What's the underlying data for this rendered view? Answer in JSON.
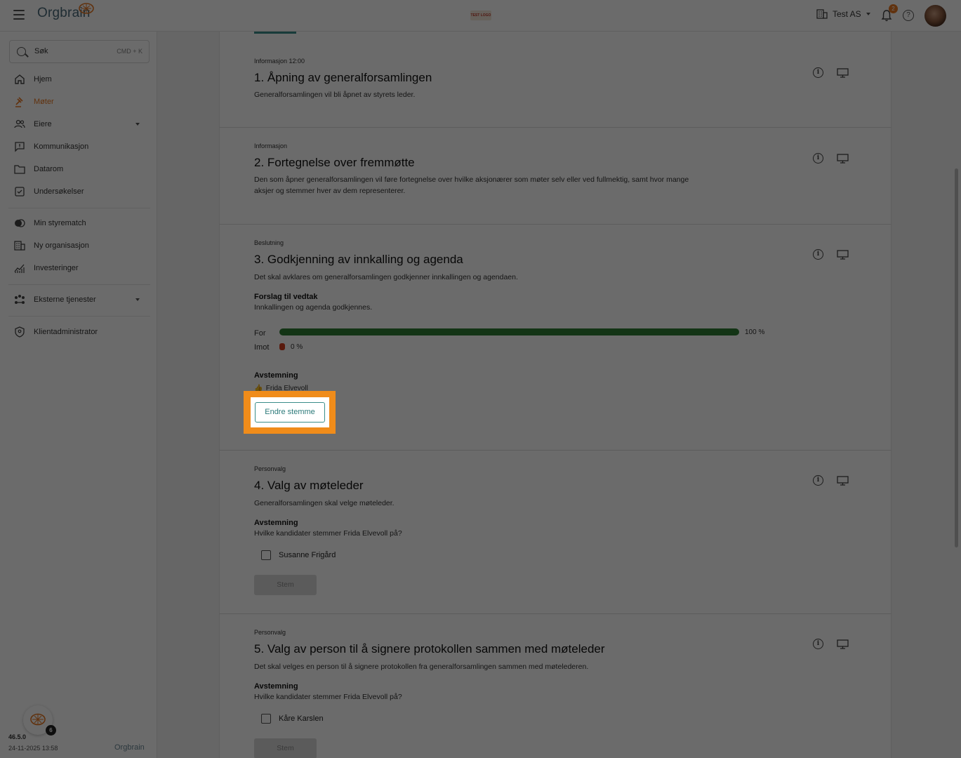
{
  "app": {
    "logo_text": "Orgbrain",
    "test_logo": "TEST LOGO",
    "org_name": "Test AS",
    "notification_count": "2",
    "help_label": "?"
  },
  "sidebar": {
    "search": {
      "placeholder": "Søk",
      "shortcut": "CMD + K"
    },
    "items": [
      {
        "label": "Hjem",
        "icon": "home-icon"
      },
      {
        "label": "Møter",
        "icon": "gavel-icon",
        "active": true
      },
      {
        "label": "Eiere",
        "icon": "people-icon",
        "expandable": true
      },
      {
        "label": "Kommunikasjon",
        "icon": "message-icon"
      },
      {
        "label": "Datarom",
        "icon": "folder-icon"
      },
      {
        "label": "Undersøkelser",
        "icon": "survey-icon"
      },
      {
        "label": "Min styrematch",
        "icon": "toggle-icon"
      },
      {
        "label": "Ny organisasjon",
        "icon": "building-icon"
      },
      {
        "label": "Investeringer",
        "icon": "chart-icon"
      },
      {
        "label": "Eksterne tjenester",
        "icon": "services-icon",
        "expandable": true
      },
      {
        "label": "Klientadministrator",
        "icon": "shield-icon"
      }
    ],
    "version": "46.5.0",
    "build_date": "24-11-2025 13:58",
    "footer_brand": "Orgbrain",
    "fab_badge": "6"
  },
  "agenda": [
    {
      "kind": "Informasjon 12:00",
      "title": "1. Åpning av generalforsamlingen",
      "description": "Generalforsamlingen vil bli åpnet av styrets leder."
    },
    {
      "kind": "Informasjon",
      "title": "2. Fortegnelse over fremmøtte",
      "description": "Den som åpner generalforsamlingen vil føre fortegnelse over hvilke aksjonærer som møter selv eller ved fullmektig, samt hvor mange aksjer og stemmer hver av dem representerer."
    },
    {
      "kind": "Beslutning",
      "title": "3. Godkjenning av innkalling og agenda",
      "description": "Det skal avklares om generalforsamlingen godkjenner innkallingen og agendaen.",
      "proposal_heading": "Forslag til vedtak",
      "proposal_text": "Innkallingen og agenda godkjennes.",
      "for_label": "For",
      "for_pct": "100 %",
      "for_fraction": 1.0,
      "against_label": "Imot",
      "against_pct": "0 %",
      "against_fraction": 0.0,
      "voting_heading": "Avstemning",
      "voter": "Frida Elvevoll",
      "change_vote_label": "Endre stemme"
    },
    {
      "kind": "Personvalg",
      "title": "4. Valg av møteleder",
      "description": "Generalforsamlingen skal velge møteleder.",
      "voting_heading": "Avstemning",
      "voting_question": "Hvilke kandidater stemmer Frida Elvevoll på?",
      "candidate": "Susanne Frigård",
      "vote_label": "Stem"
    },
    {
      "kind": "Personvalg",
      "title": "5. Valg av person til å signere protokollen sammen med møteleder",
      "description": "Det skal velges en person til å signere protokollen fra generalforsamlingen sammen med møtelederen.",
      "voting_heading": "Avstemning",
      "voting_question": "Hvilke kandidater stemmer Frida Elvevoll på?",
      "candidate": "Kåre Karslen",
      "vote_label": "Stem"
    }
  ],
  "colors": {
    "accent": "#e87722",
    "teal": "#3a8d8a",
    "for_bar": "#2f7d32",
    "against_bar": "#d43f1f",
    "highlight": "#f08c1a"
  }
}
